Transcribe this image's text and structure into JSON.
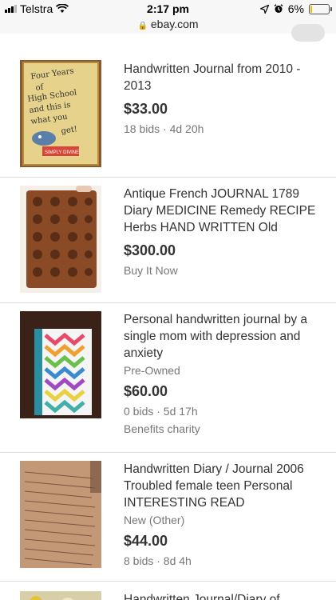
{
  "status": {
    "carrier": "Telstra",
    "time": "2:17 pm",
    "battery_percent": "6%",
    "battery_level": 0.06
  },
  "browser": {
    "url": "ebay.com"
  },
  "listings": [
    {
      "title": "Handwritten Journal from 2010 - 2013",
      "price": "$33.00",
      "meta": "18 bids · 4d 20h",
      "thumb_text": "Four Years of High School and this is what you get!",
      "thumb_sticker": "SIMPLY DIVINE"
    },
    {
      "title": "Antique French JOURNAL 1789 Diary MEDICINE Remedy RECIPE Herbs HAND WRITTEN Old",
      "price": "$300.00",
      "meta": "Buy It Now"
    },
    {
      "title": "Personal handwritten journal by a single mom with depression and anxiety",
      "condition": "Pre-Owned",
      "price": "$60.00",
      "meta": "0 bids · 5d 17h",
      "extra": "Benefits charity"
    },
    {
      "title": "Handwritten Diary / Journal 2006 Troubled female teen Personal INTERESTING READ",
      "condition": "New (Other)",
      "price": "$44.00",
      "meta": "8 bids · 8d 4h"
    },
    {
      "title": "Handwritten Journal/Diary of"
    }
  ]
}
